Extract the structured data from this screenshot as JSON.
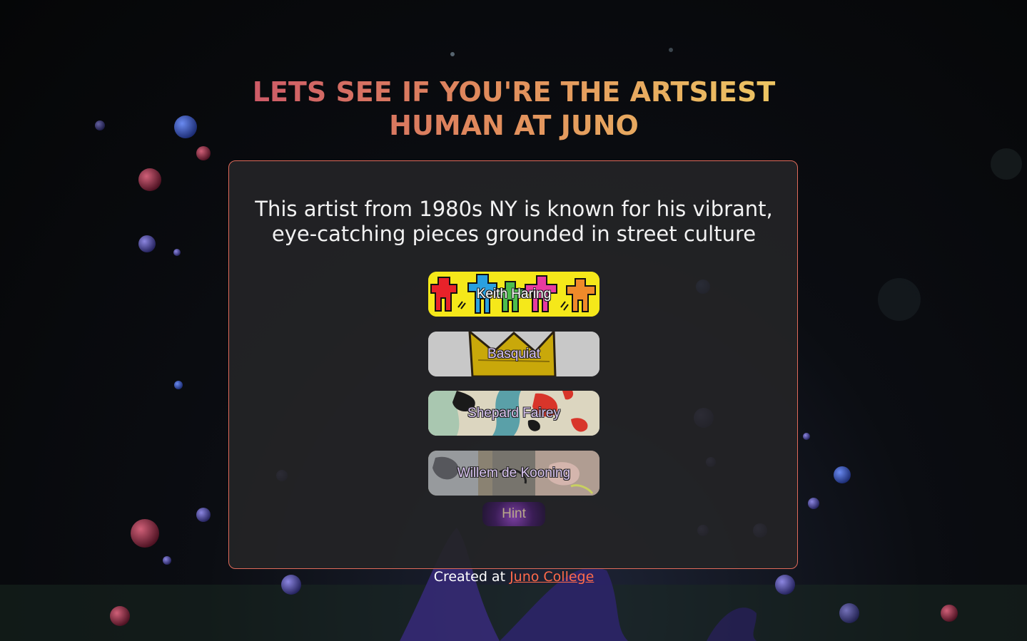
{
  "page": {
    "title": "LETS SEE IF YOU'RE THE ARTSIEST HUMAN AT JUNO"
  },
  "quiz": {
    "question": "This artist from 1980s NY is known for his vibrant, eye-catching pieces grounded in street culture",
    "answers": [
      {
        "label": "Keith Haring",
        "art": "keith-haring-figures"
      },
      {
        "label": "Basquiat",
        "art": "crown"
      },
      {
        "label": "Shepard Fairey",
        "art": "abstract-shapes"
      },
      {
        "label": "Willem de Kooning",
        "art": "abstract-painting"
      }
    ],
    "hint_label": "Hint"
  },
  "footer": {
    "prefix": "Created at ",
    "link_text": "Juno College"
  },
  "colors": {
    "title_gradient_start": "#c9506a",
    "title_gradient_end": "#f0d064",
    "card_border": "#e06a5a",
    "link": "#ff6a4a"
  }
}
